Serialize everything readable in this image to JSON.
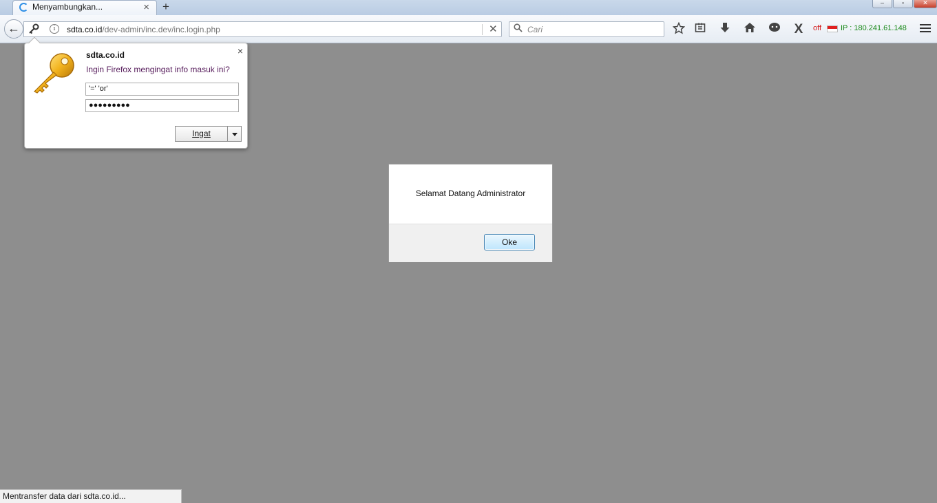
{
  "browser": {
    "tab": {
      "title": "Menyambungkan...",
      "close": "×"
    },
    "new_tab": "+",
    "window_controls": {
      "minimize": "‒",
      "maximize": "▫",
      "close": "✕"
    }
  },
  "navbar": {
    "url_host": "sdta.co.id",
    "url_path": "/dev-admin/inc.dev/inc.login.php",
    "url_stop": "✕",
    "search_placeholder": "Cari",
    "addon_off": "off",
    "addon_ip": "IP : 180.241.61.148",
    "icons": [
      "back-icon",
      "key-icon",
      "info-icon",
      "search-icon",
      "star-icon",
      "reading-list-icon",
      "download-icon",
      "home-icon",
      "chat-icon",
      "x-addon-icon",
      "menu-icon"
    ]
  },
  "password_prompt": {
    "site": "sdta.co.id",
    "question": "Ingin Firefox mengingat info masuk ini?",
    "username": "'=' 'or'",
    "password_mask": "●●●●●●●●●",
    "remember_button": "Ingat",
    "close": "×"
  },
  "alert_dialog": {
    "message": "Selamat Datang Administrator",
    "ok_button": "Oke"
  },
  "status_bar": {
    "text": "Mentransfer data dari sdta.co.id..."
  },
  "colors": {
    "page_background": "#8e8e8e",
    "ip_text": "#1a8a1a",
    "off_text": "#d42020",
    "dialog_button_border": "#3c7fb1"
  }
}
